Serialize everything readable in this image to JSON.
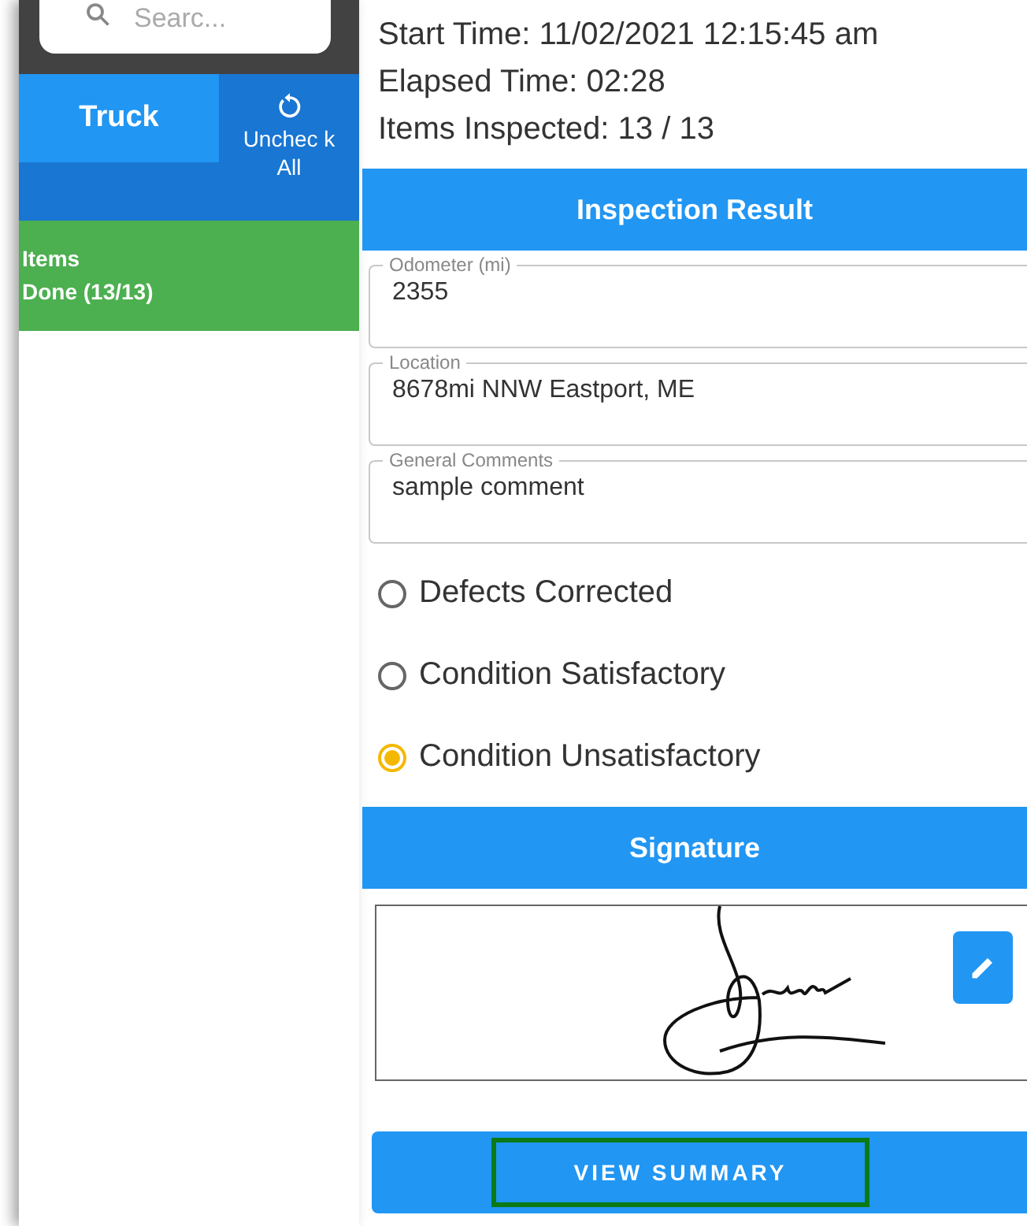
{
  "sidebar": {
    "search": {
      "placeholder": "Searc..."
    },
    "tabs": [
      {
        "label": "Truck",
        "selected": true
      }
    ],
    "uncheck_button": {
      "label": "Unchec k All"
    },
    "items": [
      {
        "title": "Items",
        "status": "Done (13/13)",
        "done": true
      }
    ]
  },
  "info": [
    "Start Time: 11/02/2021 12:15:45 am",
    "Elapsed Time: 02:28",
    "Items Inspected: 13 / 13"
  ],
  "inspection_result": {
    "title": "Inspection Result",
    "fields": [
      {
        "label": "Odometer (mi)",
        "value": "2355"
      },
      {
        "label": "Location",
        "value": "8678mi NNW Eastport, ME"
      },
      {
        "label": "General Comments",
        "value": "sample comment"
      }
    ],
    "options": [
      {
        "label": "Defects Corrected",
        "selected": false
      },
      {
        "label": "Condition Satisfactory",
        "selected": false
      },
      {
        "label": "Condition Unsatisfactory",
        "selected": true
      }
    ]
  },
  "signature": {
    "title": "Signature"
  },
  "view_summary": {
    "label": "VIEW SUMMARY",
    "highlighted": true
  }
}
